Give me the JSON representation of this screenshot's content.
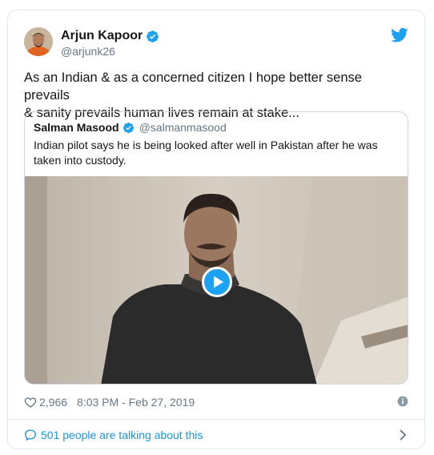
{
  "tweet": {
    "author": {
      "display_name": "Arjun Kapoor",
      "handle": "@arjunk26",
      "verified": true
    },
    "text_line1": "As an Indian & as a concerned citizen I hope better sense prevails",
    "text_line2": "& sanity prevails human lives remain at stake...",
    "likes": "2,966",
    "timestamp": "8:03 PM - Feb 27, 2019",
    "conversation": "501 people are talking about this"
  },
  "quoted": {
    "display_name": "Salman Masood",
    "handle": "@salmanmasood",
    "verified": true,
    "text": "Indian pilot says he is being looked after well in Pakistan after he was taken into custody.",
    "media_type": "video"
  },
  "icons": {
    "verified": "verified-badge-icon",
    "brand": "twitter-bird-icon",
    "like": "heart-icon",
    "info": "info-icon",
    "reply": "chat-bubble-icon",
    "more": "chevron-right-icon",
    "play": "play-icon"
  },
  "colors": {
    "accent": "#1da1f2",
    "link": "#1b95e0",
    "secondary_text": "#657786",
    "border": "#e1e8ed"
  }
}
